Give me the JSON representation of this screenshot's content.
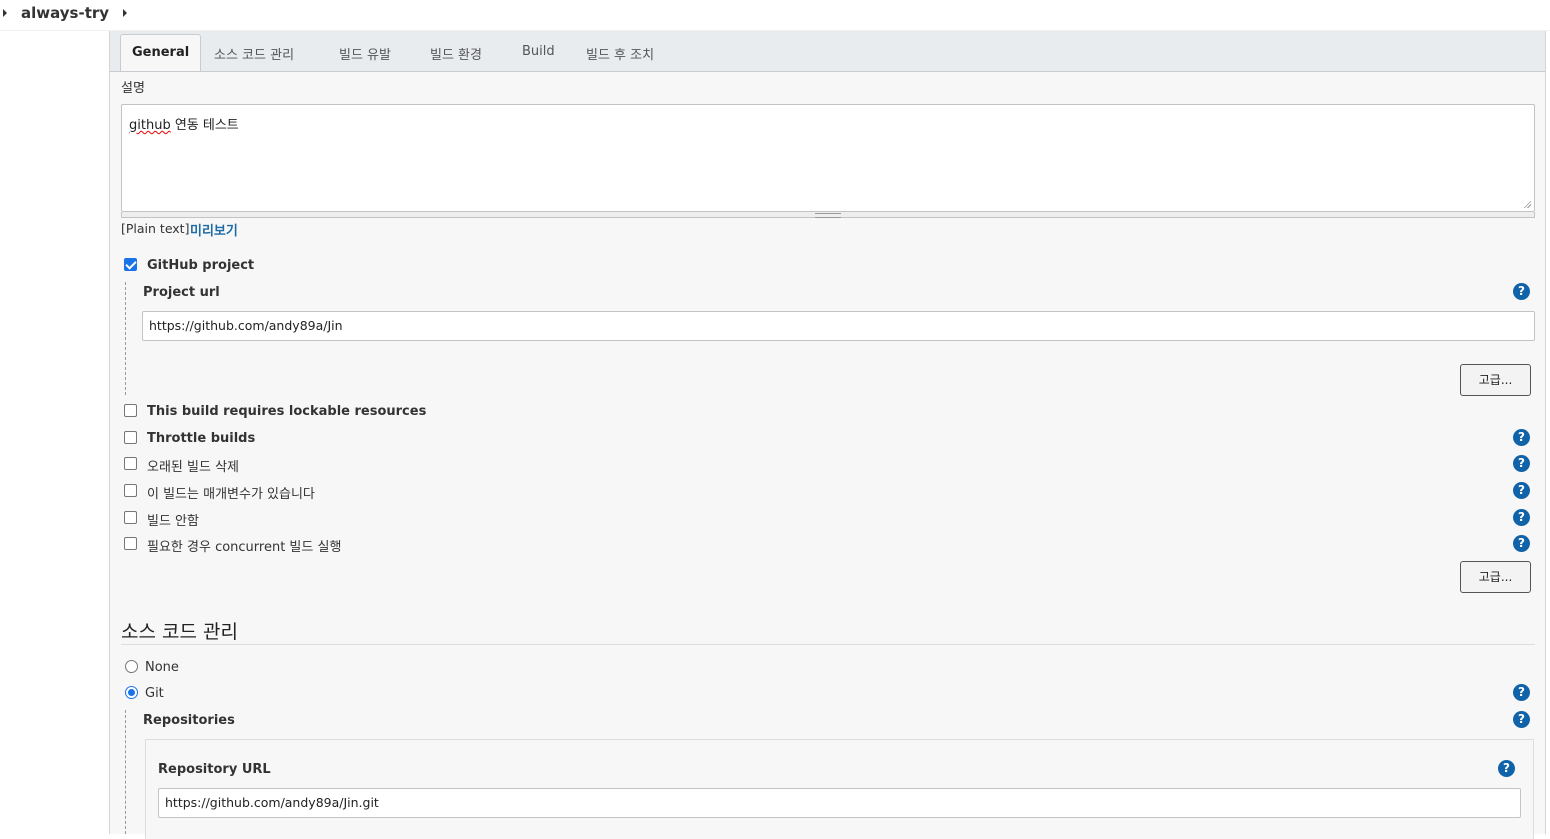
{
  "breadcrumb": {
    "title": "always-try"
  },
  "tabs": [
    {
      "label": "General"
    },
    {
      "label": "소스 코드 관리"
    },
    {
      "label": "빌드 유발"
    },
    {
      "label": "빌드 환경"
    },
    {
      "label": "Build"
    },
    {
      "label": "빌드 후 조치"
    }
  ],
  "description": {
    "label": "설명",
    "value_link": "github",
    "value_rest": " 연동 테스트",
    "format_label": "[Plain text]",
    "preview_link": "미리보기"
  },
  "github_project": {
    "label": "GitHub project",
    "checked": true,
    "project_url_label": "Project url",
    "project_url_value": "https://github.com/andy89a/Jin",
    "advanced_button": "고급..."
  },
  "options": [
    {
      "label": "This build requires lockable resources",
      "bold": true,
      "checked": false
    },
    {
      "label": "Throttle builds",
      "bold": true,
      "checked": false
    },
    {
      "label": "오래된 빌드 삭제",
      "bold": false,
      "checked": false
    },
    {
      "label": "이 빌드는 매개변수가 있습니다",
      "bold": false,
      "checked": false
    },
    {
      "label": "빌드 안함",
      "bold": false,
      "checked": false
    },
    {
      "label": "필요한 경우 concurrent 빌드 실행",
      "bold": false,
      "checked": false
    }
  ],
  "advanced_button_2": "고급...",
  "scm": {
    "title": "소스 코드 관리",
    "none_label": "None",
    "git_label": "Git",
    "selected": "Git",
    "repositories_label": "Repositories",
    "repository_url_label": "Repository URL",
    "repository_url_value": "https://github.com/andy89a/Jin.git"
  },
  "help_icon_glyph": "?"
}
